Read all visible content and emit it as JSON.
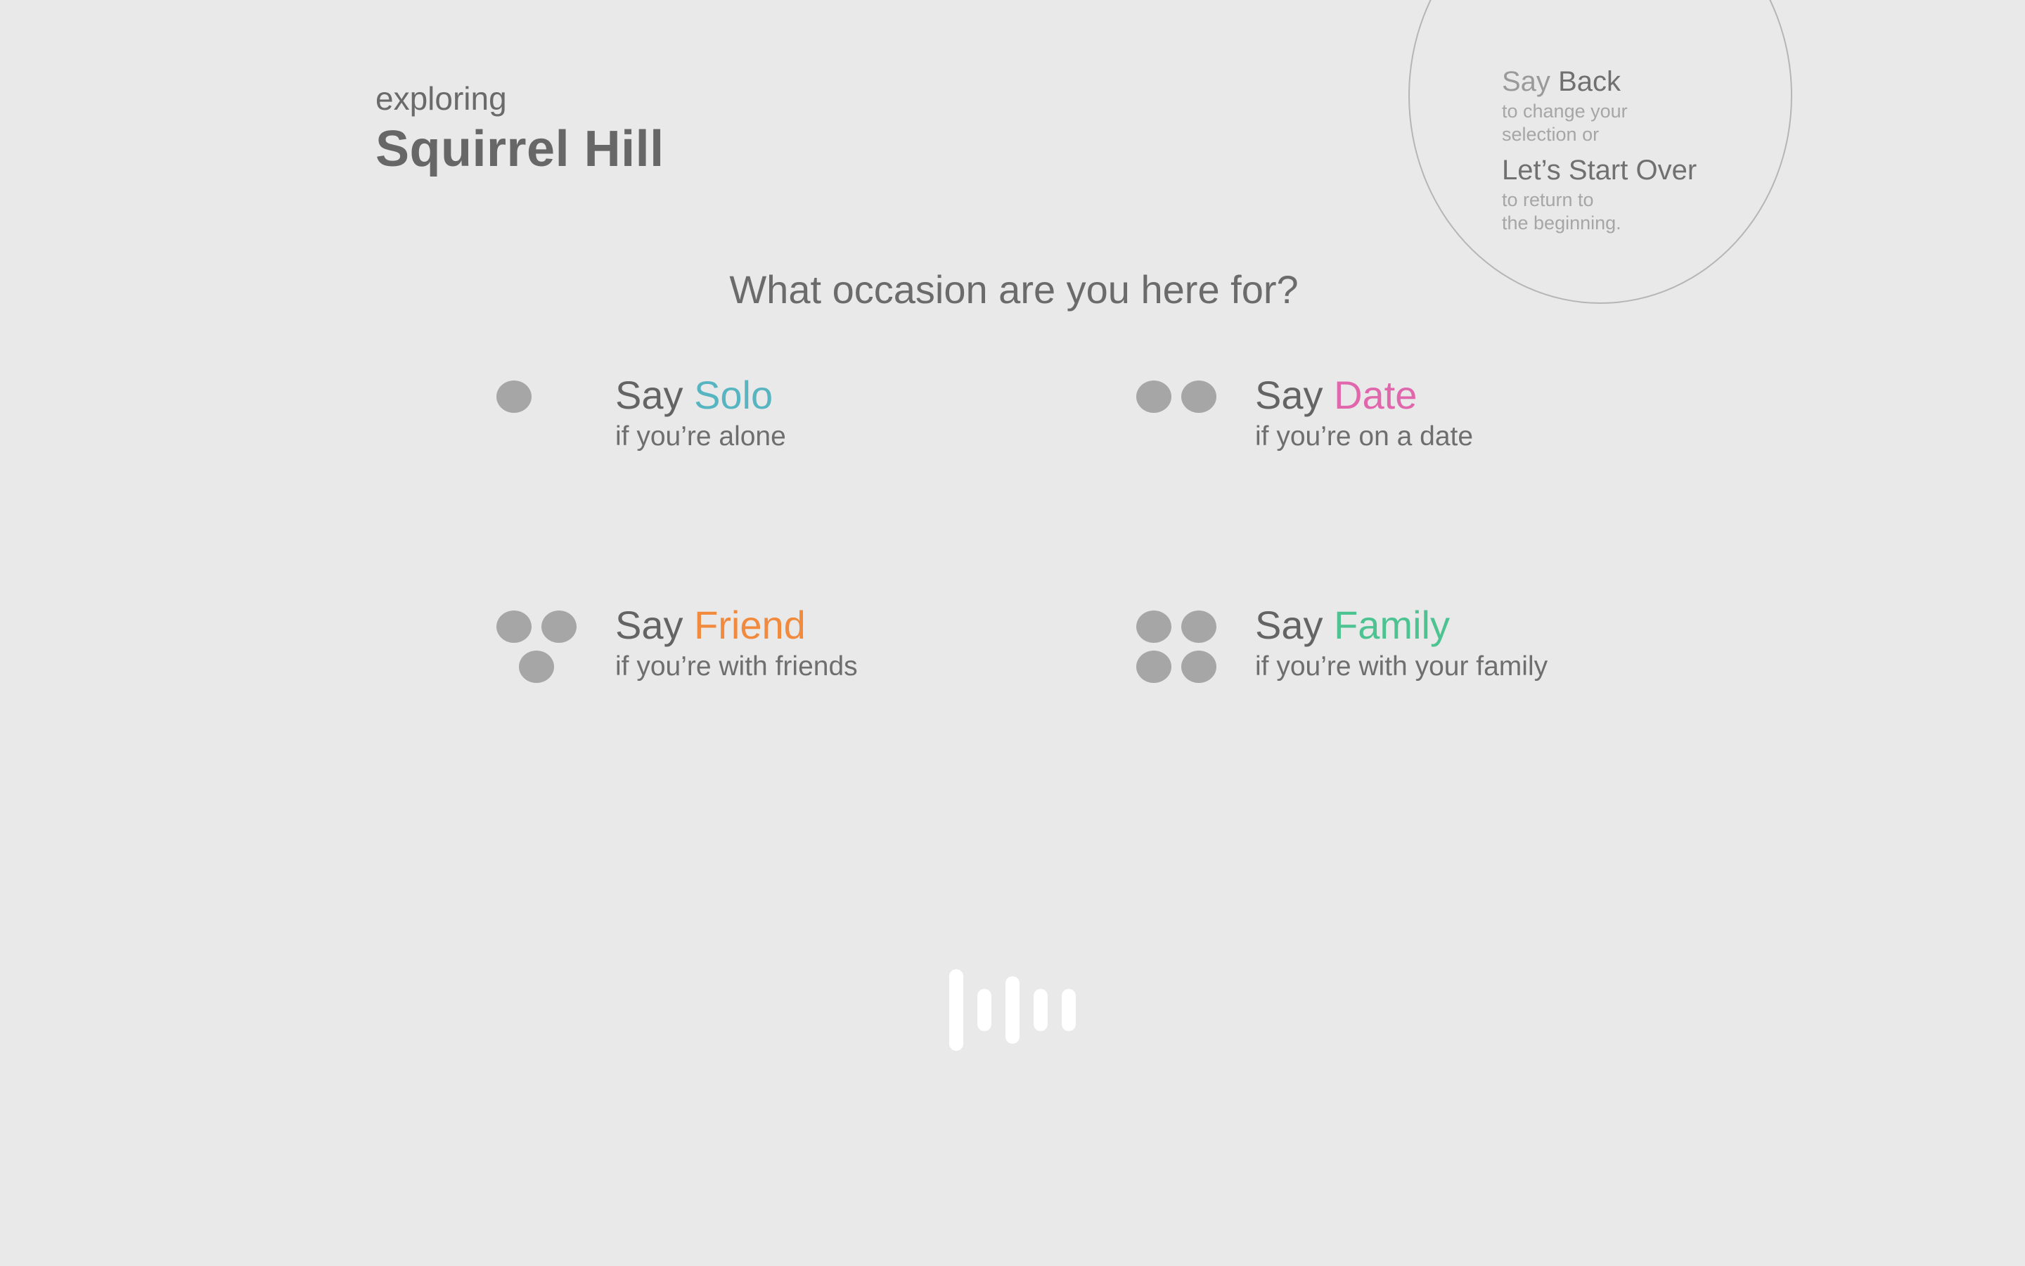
{
  "header": {
    "subtitle": "exploring",
    "title": "Squirrel Hill"
  },
  "help": {
    "say": "Say",
    "back": "Back",
    "back_desc_1": "to change your",
    "back_desc_2": "selection or",
    "start_over": "Let’s Start Over",
    "start_over_desc_1": "to return to",
    "start_over_desc_2": "the beginning."
  },
  "question": "What occasion are you here for?",
  "options": [
    {
      "say": "Say",
      "keyword": "Solo",
      "desc": "if you’re alone",
      "color": "#56b5c1",
      "dots": 1
    },
    {
      "say": "Say",
      "keyword": "Date",
      "desc": "if you’re on a date",
      "color": "#e167ad",
      "dots": 2
    },
    {
      "say": "Say",
      "keyword": "Friend",
      "desc": "if you’re with friends",
      "color": "#f18a3c",
      "dots": 3
    },
    {
      "say": "Say",
      "keyword": "Family",
      "desc": "if you’re with your family",
      "color": "#4ec392",
      "dots": 4
    }
  ],
  "voice_indicator": {
    "icon": "voice-waveform-icon",
    "color": "#ffffff"
  },
  "colors": {
    "background": "#e9e9e9",
    "text": "#666666",
    "dot": "#a6a6a6"
  }
}
